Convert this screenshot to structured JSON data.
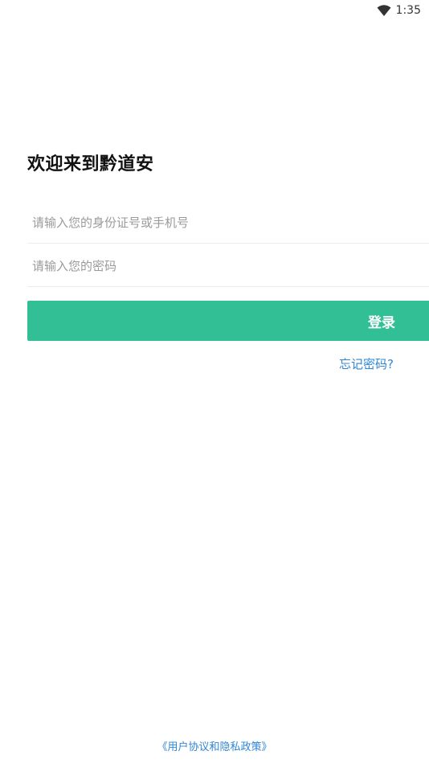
{
  "status_bar": {
    "time": "1:35",
    "icon": "wifi-icon"
  },
  "title": "欢迎来到黔道安",
  "form": {
    "id_placeholder": "请输入您的身份证号或手机号",
    "id_value": "",
    "password_placeholder": "请输入您的密码",
    "password_value": ""
  },
  "login_label": "登录",
  "forgot_label": "忘记密码?",
  "policy_label": "《用户协议和隐私政策》",
  "colors": {
    "accent": "#33bf96",
    "link": "#2f86d6"
  }
}
